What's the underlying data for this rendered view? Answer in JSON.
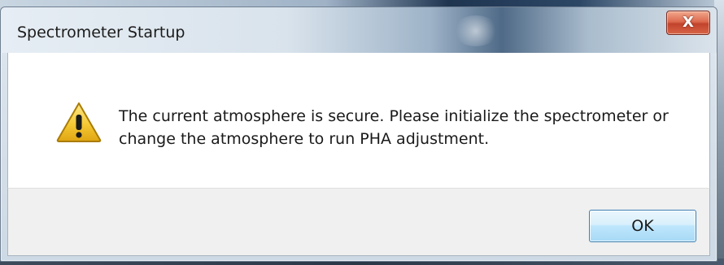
{
  "window": {
    "title": "Spectrometer Startup",
    "close_glyph": "X"
  },
  "dialog": {
    "icon": "warning-icon",
    "message_line1": "The current atmosphere is secure. Please initialize the spectrometer or",
    "message_line2": "change the atmosphere to run PHA adjustment."
  },
  "buttons": {
    "ok_label": "OK"
  },
  "colors": {
    "accent": "#3c7fb1",
    "close_button": "#c1432b",
    "warning": "#f2c230"
  }
}
